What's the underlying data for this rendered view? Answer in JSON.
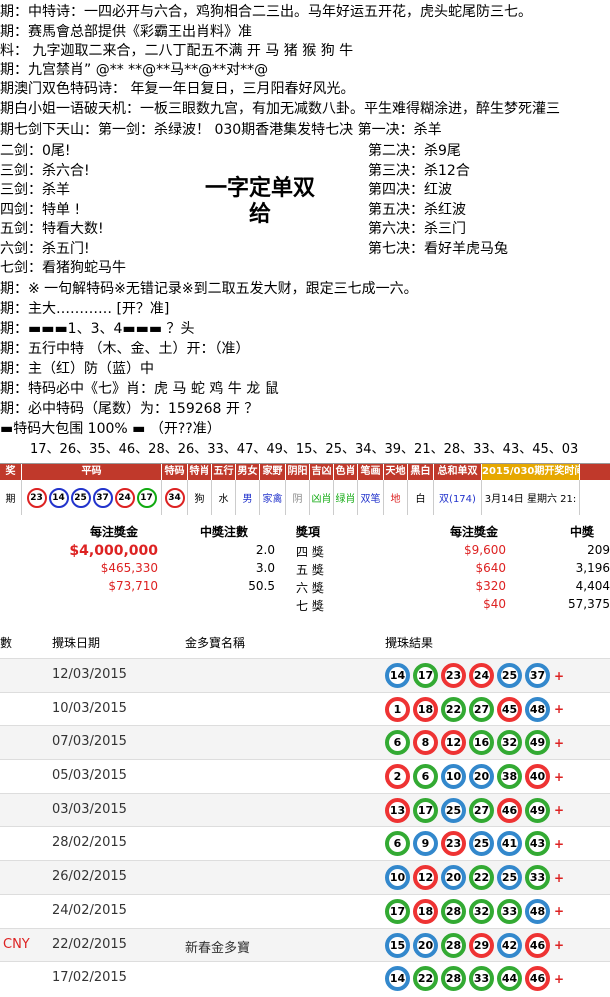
{
  "lines": [
    "期：中特诗：一四必开与六合，鸡狗相合二三出。马年好运五开花，虎头蛇尾防三七。",
    "期：赛馬會总部提供《彩霸王出肖料》准",
    "料：  九字迦取二来合，二八丁配五不满      开 马 猪 猴 狗 牛",
    "期：九宫禁肖”  @** **@**马**@**对**@",
    "期澳门双色特码诗：  年复一年日复日，三月阳春好风光。",
    "期白小姐一语破天机：一板三眼数九宫，有加无减数八卦。平生难得糊涂进，醉生梦死灌三",
    "期七剑下天山：第一剑：杀绿波！      030期香港集发特七决 第一决：杀羊"
  ],
  "left_items": [
    "二剑：0尾!",
    "三剑：杀六合!",
    "三剑：杀羊",
    "四剑：特单 !",
    "五剑：特看大数!",
    "六剑：杀五门!",
    "七剑：看猪狗蛇马牛"
  ],
  "right_items": [
    "第二决：杀9尾",
    "第三决：杀12合",
    "第四决：红波",
    "第五决：杀红波",
    "第六决：杀三门",
    "第七决：看好羊虎马兔"
  ],
  "center_title": "一字定单双",
  "center_sub": "给",
  "lines2": [
    "期：※ 一句解特码※无错记录※到二取五发大财，跟定三七成一六。",
    "期：主大………… [开？准]",
    "期：▬▬▬1、3、4▬▬▬ ？头",
    "期：五行中特  （木、金、土）开：（准）",
    "期：主（红）防（蓝）中",
    "期：特码必中《七》肖：虎 马 蛇 鸡 牛 龙 鼠",
    "期：必中特码（尾数）为：159268  开 ？",
    "▬特码大包围 100% ▬     （开??准）"
  ],
  "number_row": "17、26、35、46、28、26、33、47、49、15、25、34、39、21、28、33、43、45、03",
  "result_bar": {
    "headers": [
      "奖",
      "平码",
      "特码",
      "特肖",
      "五行",
      "男女",
      "家野",
      "阴阳",
      "吉凶",
      "色肖",
      "笔画",
      "天地",
      "黑白",
      "总和单双",
      "2015/030期开奖时间"
    ],
    "row_label": "期",
    "flat_numbers": [
      "23",
      "14",
      "25",
      "37",
      "24",
      "17"
    ],
    "flat_colors": [
      "r",
      "b",
      "b",
      "b",
      "r",
      "g"
    ],
    "special": "34",
    "special_color": "r",
    "attrs": [
      "狗",
      "水",
      "男",
      "家禽",
      "阴",
      "凶肖",
      "绿肖",
      "双笔",
      "地",
      "白",
      "双(174)",
      "3月14日 星期六 21:"
    ],
    "accent": "#c0392b"
  },
  "prize": {
    "h_left": [
      "每注獎金",
      "中獎注數"
    ],
    "h_right": [
      "獎項",
      "每注獎金",
      "中獎"
    ],
    "left_rows": [
      [
        "$4,000,000",
        "2.0"
      ],
      [
        "$465,330",
        "3.0"
      ],
      [
        "$73,710",
        "50.5"
      ]
    ],
    "right_rows": [
      [
        "四 獎",
        "$9,600",
        "209"
      ],
      [
        "五 獎",
        "$640",
        "3,196"
      ],
      [
        "六 獎",
        "$320",
        "4,404"
      ],
      [
        "七 獎",
        "$40",
        "57,375"
      ]
    ]
  },
  "draws": {
    "h_col1": "數",
    "h_col2": "攪珠日期",
    "h_col3": "金多寶名稱",
    "h_col4": "攪珠結果",
    "rows": [
      {
        "tag": "",
        "date": "12/03/2015",
        "note": "",
        "balls": [
          "14",
          "17",
          "23",
          "24",
          "25",
          "37"
        ],
        "colors": [
          "b",
          "g",
          "r",
          "r",
          "b",
          "b"
        ]
      },
      {
        "tag": "",
        "date": "10/03/2015",
        "note": "",
        "balls": [
          "1",
          "18",
          "22",
          "27",
          "45",
          "48"
        ],
        "colors": [
          "r",
          "r",
          "g",
          "g",
          "r",
          "b"
        ]
      },
      {
        "tag": "",
        "date": "07/03/2015",
        "note": "",
        "balls": [
          "6",
          "8",
          "12",
          "16",
          "32",
          "49"
        ],
        "colors": [
          "g",
          "r",
          "r",
          "g",
          "g",
          "g"
        ]
      },
      {
        "tag": "",
        "date": "05/03/2015",
        "note": "",
        "balls": [
          "2",
          "6",
          "10",
          "20",
          "38",
          "40"
        ],
        "colors": [
          "r",
          "g",
          "b",
          "b",
          "g",
          "r"
        ]
      },
      {
        "tag": "",
        "date": "03/03/2015",
        "note": "",
        "balls": [
          "13",
          "17",
          "25",
          "27",
          "46",
          "49"
        ],
        "colors": [
          "r",
          "g",
          "b",
          "g",
          "r",
          "g"
        ]
      },
      {
        "tag": "",
        "date": "28/02/2015",
        "note": "",
        "balls": [
          "6",
          "9",
          "23",
          "25",
          "41",
          "43"
        ],
        "colors": [
          "g",
          "b",
          "r",
          "b",
          "b",
          "g"
        ]
      },
      {
        "tag": "",
        "date": "26/02/2015",
        "note": "",
        "balls": [
          "10",
          "12",
          "20",
          "22",
          "25",
          "33"
        ],
        "colors": [
          "b",
          "r",
          "b",
          "g",
          "b",
          "g"
        ]
      },
      {
        "tag": "",
        "date": "24/02/2015",
        "note": "",
        "balls": [
          "17",
          "18",
          "28",
          "32",
          "33",
          "48"
        ],
        "colors": [
          "g",
          "r",
          "g",
          "g",
          "g",
          "b"
        ]
      },
      {
        "tag": "CNY",
        "date": "22/02/2015",
        "note": "新春金多寶",
        "balls": [
          "15",
          "20",
          "28",
          "29",
          "42",
          "46"
        ],
        "colors": [
          "b",
          "b",
          "g",
          "r",
          "b",
          "r"
        ]
      },
      {
        "tag": "",
        "date": "17/02/2015",
        "note": "",
        "balls": [
          "14",
          "22",
          "28",
          "33",
          "44",
          "46"
        ],
        "colors": [
          "b",
          "g",
          "g",
          "g",
          "g",
          "r"
        ]
      }
    ],
    "plus_sign": "+"
  }
}
